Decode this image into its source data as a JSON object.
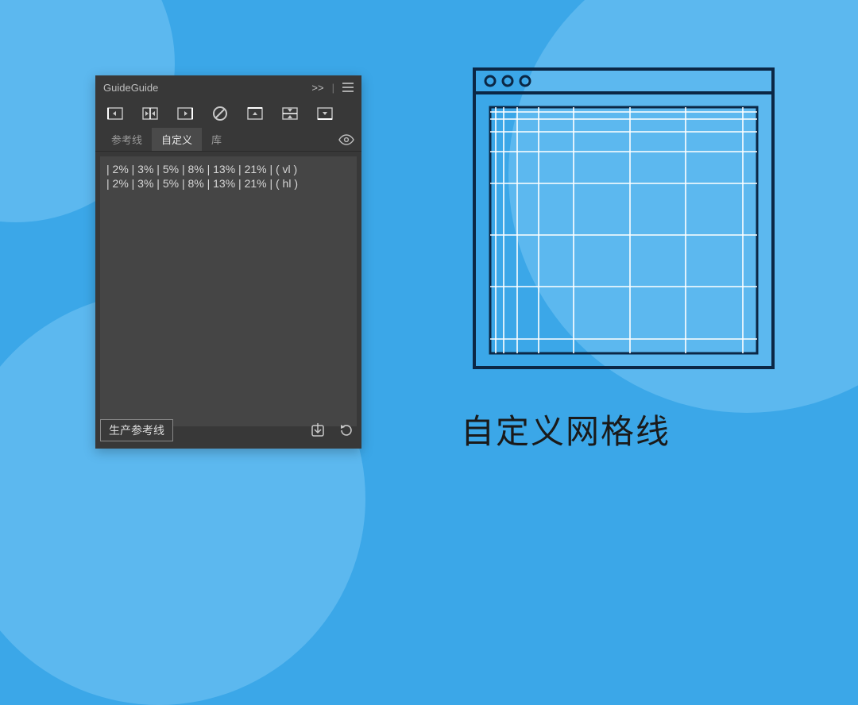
{
  "panel": {
    "title": "GuideGuide",
    "collapse_label": ">>",
    "tabs": {
      "reference": "参考线",
      "custom": "自定义",
      "library": "库"
    },
    "spec": {
      "line1": "| 2% | 3% | 5% | 8% | 13% | 21% | ( vl )",
      "line2": "| 2% | 3% | 5% | 8% | 13% | 21% | ( hl )"
    },
    "generate_label": "生产参考线"
  },
  "caption": "自定义网格线",
  "chart_data": {
    "type": "table",
    "title": "GuideGuide custom grid specification",
    "series": [
      {
        "name": "vl (vertical lines)",
        "values": [
          2,
          3,
          5,
          8,
          13,
          21
        ],
        "unit": "%"
      },
      {
        "name": "hl (horizontal lines)",
        "values": [
          2,
          3,
          5,
          8,
          13,
          21
        ],
        "unit": "%"
      }
    ]
  }
}
